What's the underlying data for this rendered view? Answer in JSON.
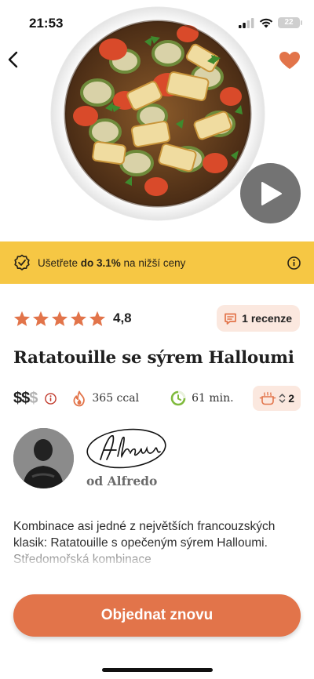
{
  "status_bar": {
    "time": "21:53",
    "battery_level": "22",
    "icons": [
      "cellular-signal-icon",
      "wifi-icon",
      "battery-icon"
    ]
  },
  "hero": {
    "image_subject": "ratatouille-halloumi-dish",
    "icons": [
      "back-arrow-icon",
      "heart-icon",
      "play-icon"
    ]
  },
  "savings": {
    "prefix": "Ušetřete ",
    "highlight": "do 3.1%",
    "suffix": " na nižší ceny",
    "icons": [
      "badge-check-icon",
      "info-icon"
    ]
  },
  "rating": {
    "stars": 5,
    "value": "4,8",
    "reviews_label": "1 recenze",
    "icons": [
      "star-icon",
      "review-icon"
    ]
  },
  "recipe": {
    "title": "Ratatouille se sýrem Halloumi",
    "price_level": "$$",
    "price_level_dim": "$",
    "calories": "365 ccal",
    "time": "61 min.",
    "servings": "2",
    "icons": [
      "info-icon",
      "flame-icon",
      "timer-icon",
      "cooking-pot-icon",
      "stepper-arrows-icon"
    ]
  },
  "author": {
    "name": "od Alfredo",
    "signature": "Alfredo",
    "icons": [
      "avatar",
      "signature"
    ]
  },
  "description": {
    "text": "Kombinace asi jedné z největších francouzských klasik: Ratatouille s opečeným sýrem Halloumi. Středomořská kombinace"
  },
  "cta": {
    "label": "Objednat znovu"
  },
  "colors": {
    "accent": "#e2744a",
    "banner": "#f6c744",
    "chip": "#fbe8df",
    "time_green": "#7fba3c"
  }
}
